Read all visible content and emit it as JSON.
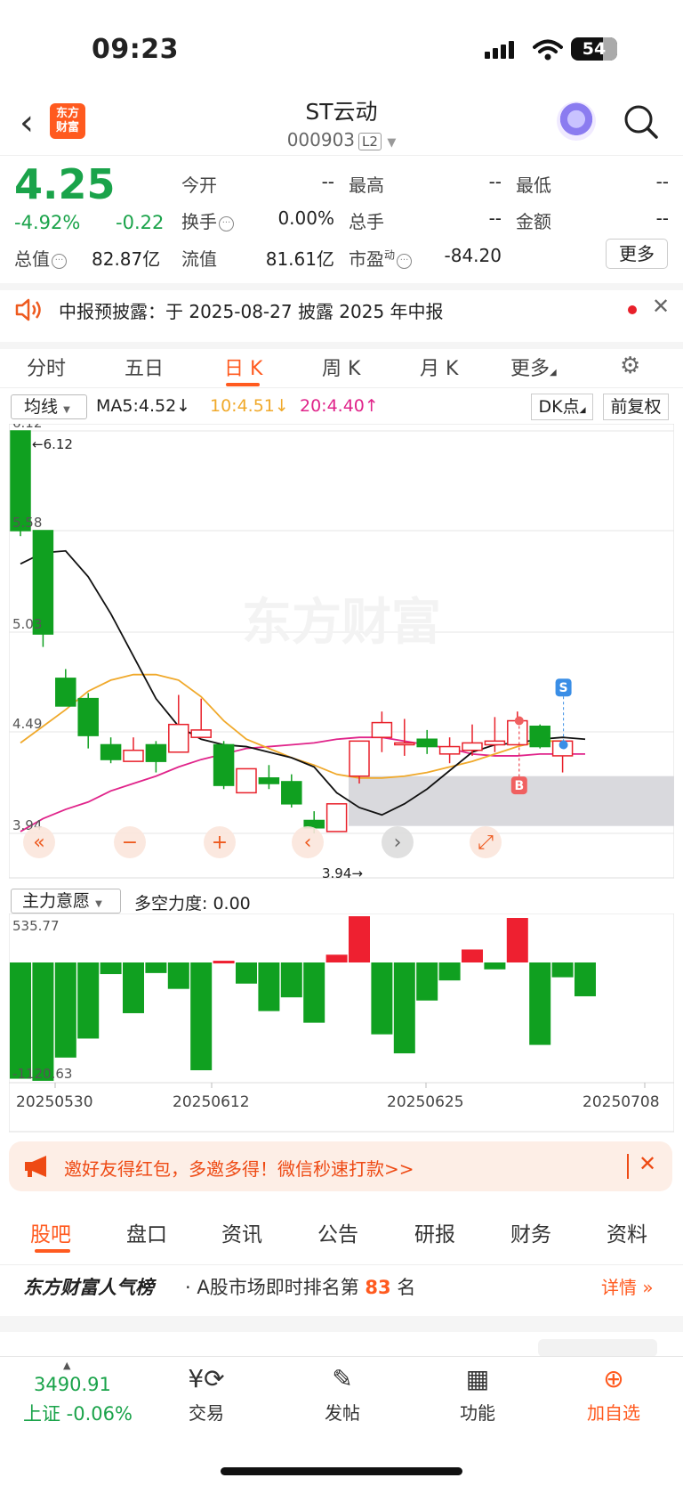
{
  "status": {
    "time": "09:23",
    "battery": "54"
  },
  "header": {
    "name": "ST云动",
    "code": "000903",
    "level": "L2",
    "logo": "东方\n财富"
  },
  "quote": {
    "price": "4.25",
    "change_pct": "-4.92%",
    "change_val": "-0.22",
    "total_label": "总值",
    "total_value": "82.87亿",
    "open_label": "今开",
    "open_value": "--",
    "high_label": "最高",
    "high_value": "--",
    "low_label": "最低",
    "low_value": "--",
    "turnover_label": "换手",
    "turnover_value": "0.00%",
    "volume_label": "总手",
    "volume_value": "--",
    "amount_label": "金额",
    "amount_value": "--",
    "float_label": "流值",
    "float_value": "81.61亿",
    "pe_label": "市盈",
    "pe_sup": "动",
    "pe_value": "-84.20",
    "more": "更多"
  },
  "notice": {
    "text": "中报预披露：于 2025-08-27 披露 2025 年中报"
  },
  "kline_tabs": [
    "分时",
    "五日",
    "日 K",
    "周 K",
    "月 K",
    "更多"
  ],
  "ma": {
    "select": "均线",
    "ma5": "MA5:4.52↓",
    "ma10": "10:4.51↓",
    "ma20": "20:4.40↑",
    "dk": "DK点",
    "fq": "前复权"
  },
  "chart_data": {
    "type": "candlestick",
    "watermark": "东方财富",
    "price_ticks": [
      "6.12",
      "5.58",
      "5.03",
      "4.49",
      "3.94"
    ],
    "max_label": "6.12",
    "min_label": "3.94",
    "signals": {
      "sell": "S",
      "buy": "B"
    },
    "candles": [
      {
        "o": 6.12,
        "c": 5.58,
        "h": 6.12,
        "l": 5.55
      },
      {
        "o": 5.58,
        "c": 5.02,
        "h": 5.43,
        "l": 4.95
      },
      {
        "o": 4.78,
        "c": 4.63,
        "h": 4.83,
        "l": 4.63
      },
      {
        "o": 4.67,
        "c": 4.47,
        "h": 4.7,
        "l": 4.4
      },
      {
        "o": 4.42,
        "c": 4.34,
        "h": 4.46,
        "l": 4.32
      },
      {
        "o": 4.33,
        "c": 4.39,
        "h": 4.46,
        "l": 4.33
      },
      {
        "o": 4.42,
        "c": 4.33,
        "h": 4.44,
        "l": 4.27
      },
      {
        "o": 4.38,
        "c": 4.53,
        "h": 4.69,
        "l": 4.38
      },
      {
        "o": 4.46,
        "c": 4.5,
        "h": 4.67,
        "l": 4.46
      },
      {
        "o": 4.42,
        "c": 4.2,
        "h": 4.44,
        "l": 4.18
      },
      {
        "o": 4.16,
        "c": 4.29,
        "h": 4.29,
        "l": 4.16
      },
      {
        "o": 4.24,
        "c": 4.21,
        "h": 4.31,
        "l": 4.18
      },
      {
        "o": 4.22,
        "c": 4.1,
        "h": 4.26,
        "l": 4.08
      },
      {
        "o": 4.01,
        "c": 3.97,
        "h": 4.06,
        "l": 3.94
      },
      {
        "o": 3.95,
        "c": 4.1,
        "h": 4.1,
        "l": 3.95
      },
      {
        "o": 4.25,
        "c": 4.44,
        "h": 4.44,
        "l": 4.21
      },
      {
        "o": 4.46,
        "c": 4.54,
        "h": 4.6,
        "l": 4.38
      },
      {
        "o": 4.42,
        "c": 4.43,
        "h": 4.56,
        "l": 4.36
      },
      {
        "o": 4.45,
        "c": 4.41,
        "h": 4.5,
        "l": 4.37
      },
      {
        "o": 4.37,
        "c": 4.41,
        "h": 4.46,
        "l": 4.32
      },
      {
        "o": 4.39,
        "c": 4.43,
        "h": 4.53,
        "l": 4.36
      },
      {
        "o": 4.42,
        "c": 4.44,
        "h": 4.57,
        "l": 4.38
      },
      {
        "o": 4.42,
        "c": 4.55,
        "h": 4.6,
        "l": 4.42
      },
      {
        "o": 4.52,
        "c": 4.41,
        "h": 4.53,
        "l": 4.4
      },
      {
        "o": 4.36,
        "c": 4.44,
        "h": 4.44,
        "l": 4.27
      }
    ],
    "ma5": [
      5.4,
      5.46,
      5.47,
      5.33,
      5.13,
      4.9,
      4.67,
      4.52,
      4.45,
      4.42,
      4.41,
      4.38,
      4.35,
      4.3,
      4.16,
      4.08,
      4.04,
      4.1,
      4.18,
      4.28,
      4.38,
      4.42,
      4.43,
      4.45,
      4.46,
      4.45
    ],
    "ma10": [
      4.43,
      4.52,
      4.61,
      4.71,
      4.77,
      4.8,
      4.8,
      4.77,
      4.68,
      4.55,
      4.45,
      4.4,
      4.35,
      4.31,
      4.26,
      4.24,
      4.24,
      4.25,
      4.27,
      4.3,
      4.33,
      4.37,
      4.41,
      4.44,
      4.44
    ],
    "ma20": [
      3.95,
      4.02,
      4.07,
      4.11,
      4.17,
      4.21,
      4.25,
      4.3,
      4.34,
      4.37,
      4.4,
      4.41,
      4.42,
      4.43,
      4.45,
      4.46,
      4.46,
      4.44,
      4.42,
      4.4,
      4.37,
      4.36,
      4.36,
      4.37,
      4.37,
      4.37
    ],
    "sub_indicator": {
      "select": "主力意愿",
      "label": "多空力度: 0.00",
      "max": "535.77",
      "min": "-1120.63",
      "values": [
        -1100,
        -1120,
        -900,
        -720,
        -110,
        -480,
        -100,
        -250,
        -1020,
        20,
        -200,
        -460,
        -330,
        -570,
        90,
        535,
        -680,
        -860,
        -360,
        -170,
        150,
        -65,
        515,
        -780,
        -140,
        -320
      ]
    },
    "dates": [
      "20250530",
      "20250612",
      "20250625",
      "20250708"
    ]
  },
  "banner": {
    "text": "邀好友得红包，多邀多得！微信秒速打款>>"
  },
  "section_tabs": [
    "股吧",
    "盘口",
    "资讯",
    "公告",
    "研报",
    "财务",
    "资料"
  ],
  "rank": {
    "brand": "东方财富人气榜",
    "prefix": "· A股市场即时排名第",
    "num": "83",
    "suffix": "名",
    "detail": "详情"
  },
  "bottom": {
    "index_value": "3490.91",
    "index_label": "上证 -0.06%",
    "items": [
      "交易",
      "发帖",
      "功能",
      "加自选"
    ]
  }
}
